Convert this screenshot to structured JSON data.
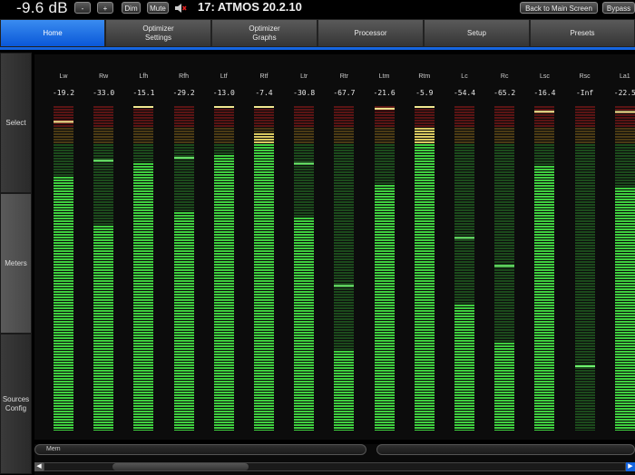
{
  "header": {
    "level": "-9.6 dB",
    "minus_label": "-",
    "plus_label": "+",
    "dim_label": "Dim",
    "mute_label": "Mute",
    "speaker_icon": "speaker-muted-icon",
    "preset": "17: ATMOS 20.2.10",
    "back_label": "Back to Main Screen",
    "bypass_label": "Bypass"
  },
  "tabs": [
    "Home",
    "Optimizer\nSettings",
    "Optimizer\nGraphs",
    "Processor",
    "Setup",
    "Presets"
  ],
  "active_tab": "Home",
  "sidebar": [
    "Select",
    "Meters",
    "Sources\nConfig"
  ],
  "active_side": "Meters",
  "channels": [
    {
      "name": "Lw",
      "value": "-19.2"
    },
    {
      "name": "Rw",
      "value": "-33.0"
    },
    {
      "name": "Lfh",
      "value": "-15.1"
    },
    {
      "name": "Rfh",
      "value": "-29.2"
    },
    {
      "name": "Ltf",
      "value": "-13.0"
    },
    {
      "name": "Rtf",
      "value": "-7.4"
    },
    {
      "name": "Ltr",
      "value": "-30.8"
    },
    {
      "name": "Rtr",
      "value": "-67.7"
    },
    {
      "name": "Ltm",
      "value": "-21.6"
    },
    {
      "name": "Rtm",
      "value": "-5.9"
    },
    {
      "name": "Lc",
      "value": "-54.4"
    },
    {
      "name": "Rc",
      "value": "-65.2"
    },
    {
      "name": "Lsc",
      "value": "-16.4"
    },
    {
      "name": "Rsc",
      "value": "-Inf"
    },
    {
      "name": "La1",
      "value": "-22.5"
    }
  ],
  "bottom": {
    "mem_label": "Mem"
  },
  "colors": {
    "accent": "#1565e0",
    "meter_green": "#3fcf3f",
    "meter_dim_green": "#1c4a1c",
    "meter_red": "#7a1a1a"
  }
}
